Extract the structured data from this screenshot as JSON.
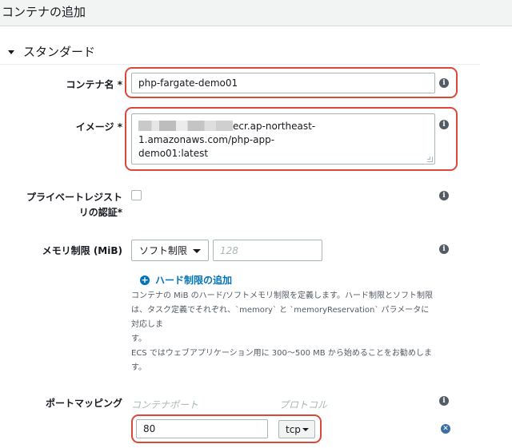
{
  "header": {
    "title": "コンテナの追加"
  },
  "section": {
    "title": "スタンダード"
  },
  "container_name": {
    "label": "コンテナ名 *",
    "value": "php-fargate-demo01"
  },
  "image": {
    "label": "イメージ *",
    "value_line1": "ecr.ap-northeast-1.amazonaws.com/php-app-",
    "value_line2": "demo01:latest"
  },
  "private_registry": {
    "label_line1": "プライベートレジスト",
    "label_line2": "リの認証*"
  },
  "memory": {
    "label": "メモリ制限 (MiB)",
    "limit_type": "ソフト制限",
    "placeholder": "128",
    "add_hard_limit": "ハード制限の追加",
    "help_lines": [
      "コンテナの MiB のハード/ソフトメモリ制限を定義します。ハード制限とソフト制限",
      "は、タスク定義でそれぞれ、`memory` と `memoryReservation` パラメータに対応しま",
      "す。",
      "ECS ではウェブアプリケーション用に 300〜500 MB から始めることをお勧めしま",
      "す。"
    ]
  },
  "port_mapping": {
    "label": "ポートマッピング",
    "container_port_header": "コンテナポート",
    "protocol_header": "プロトコル",
    "rows": [
      {
        "container_port": "80",
        "protocol": "tcp"
      }
    ]
  },
  "icons": {
    "info": "info-icon",
    "plus": "plus-circle-icon",
    "remove": "remove-circle-icon",
    "collapse": "caret-down-icon"
  },
  "colors": {
    "highlight": "#d9483b",
    "link": "#0073bb",
    "header_bg": "#f2f3f3"
  }
}
